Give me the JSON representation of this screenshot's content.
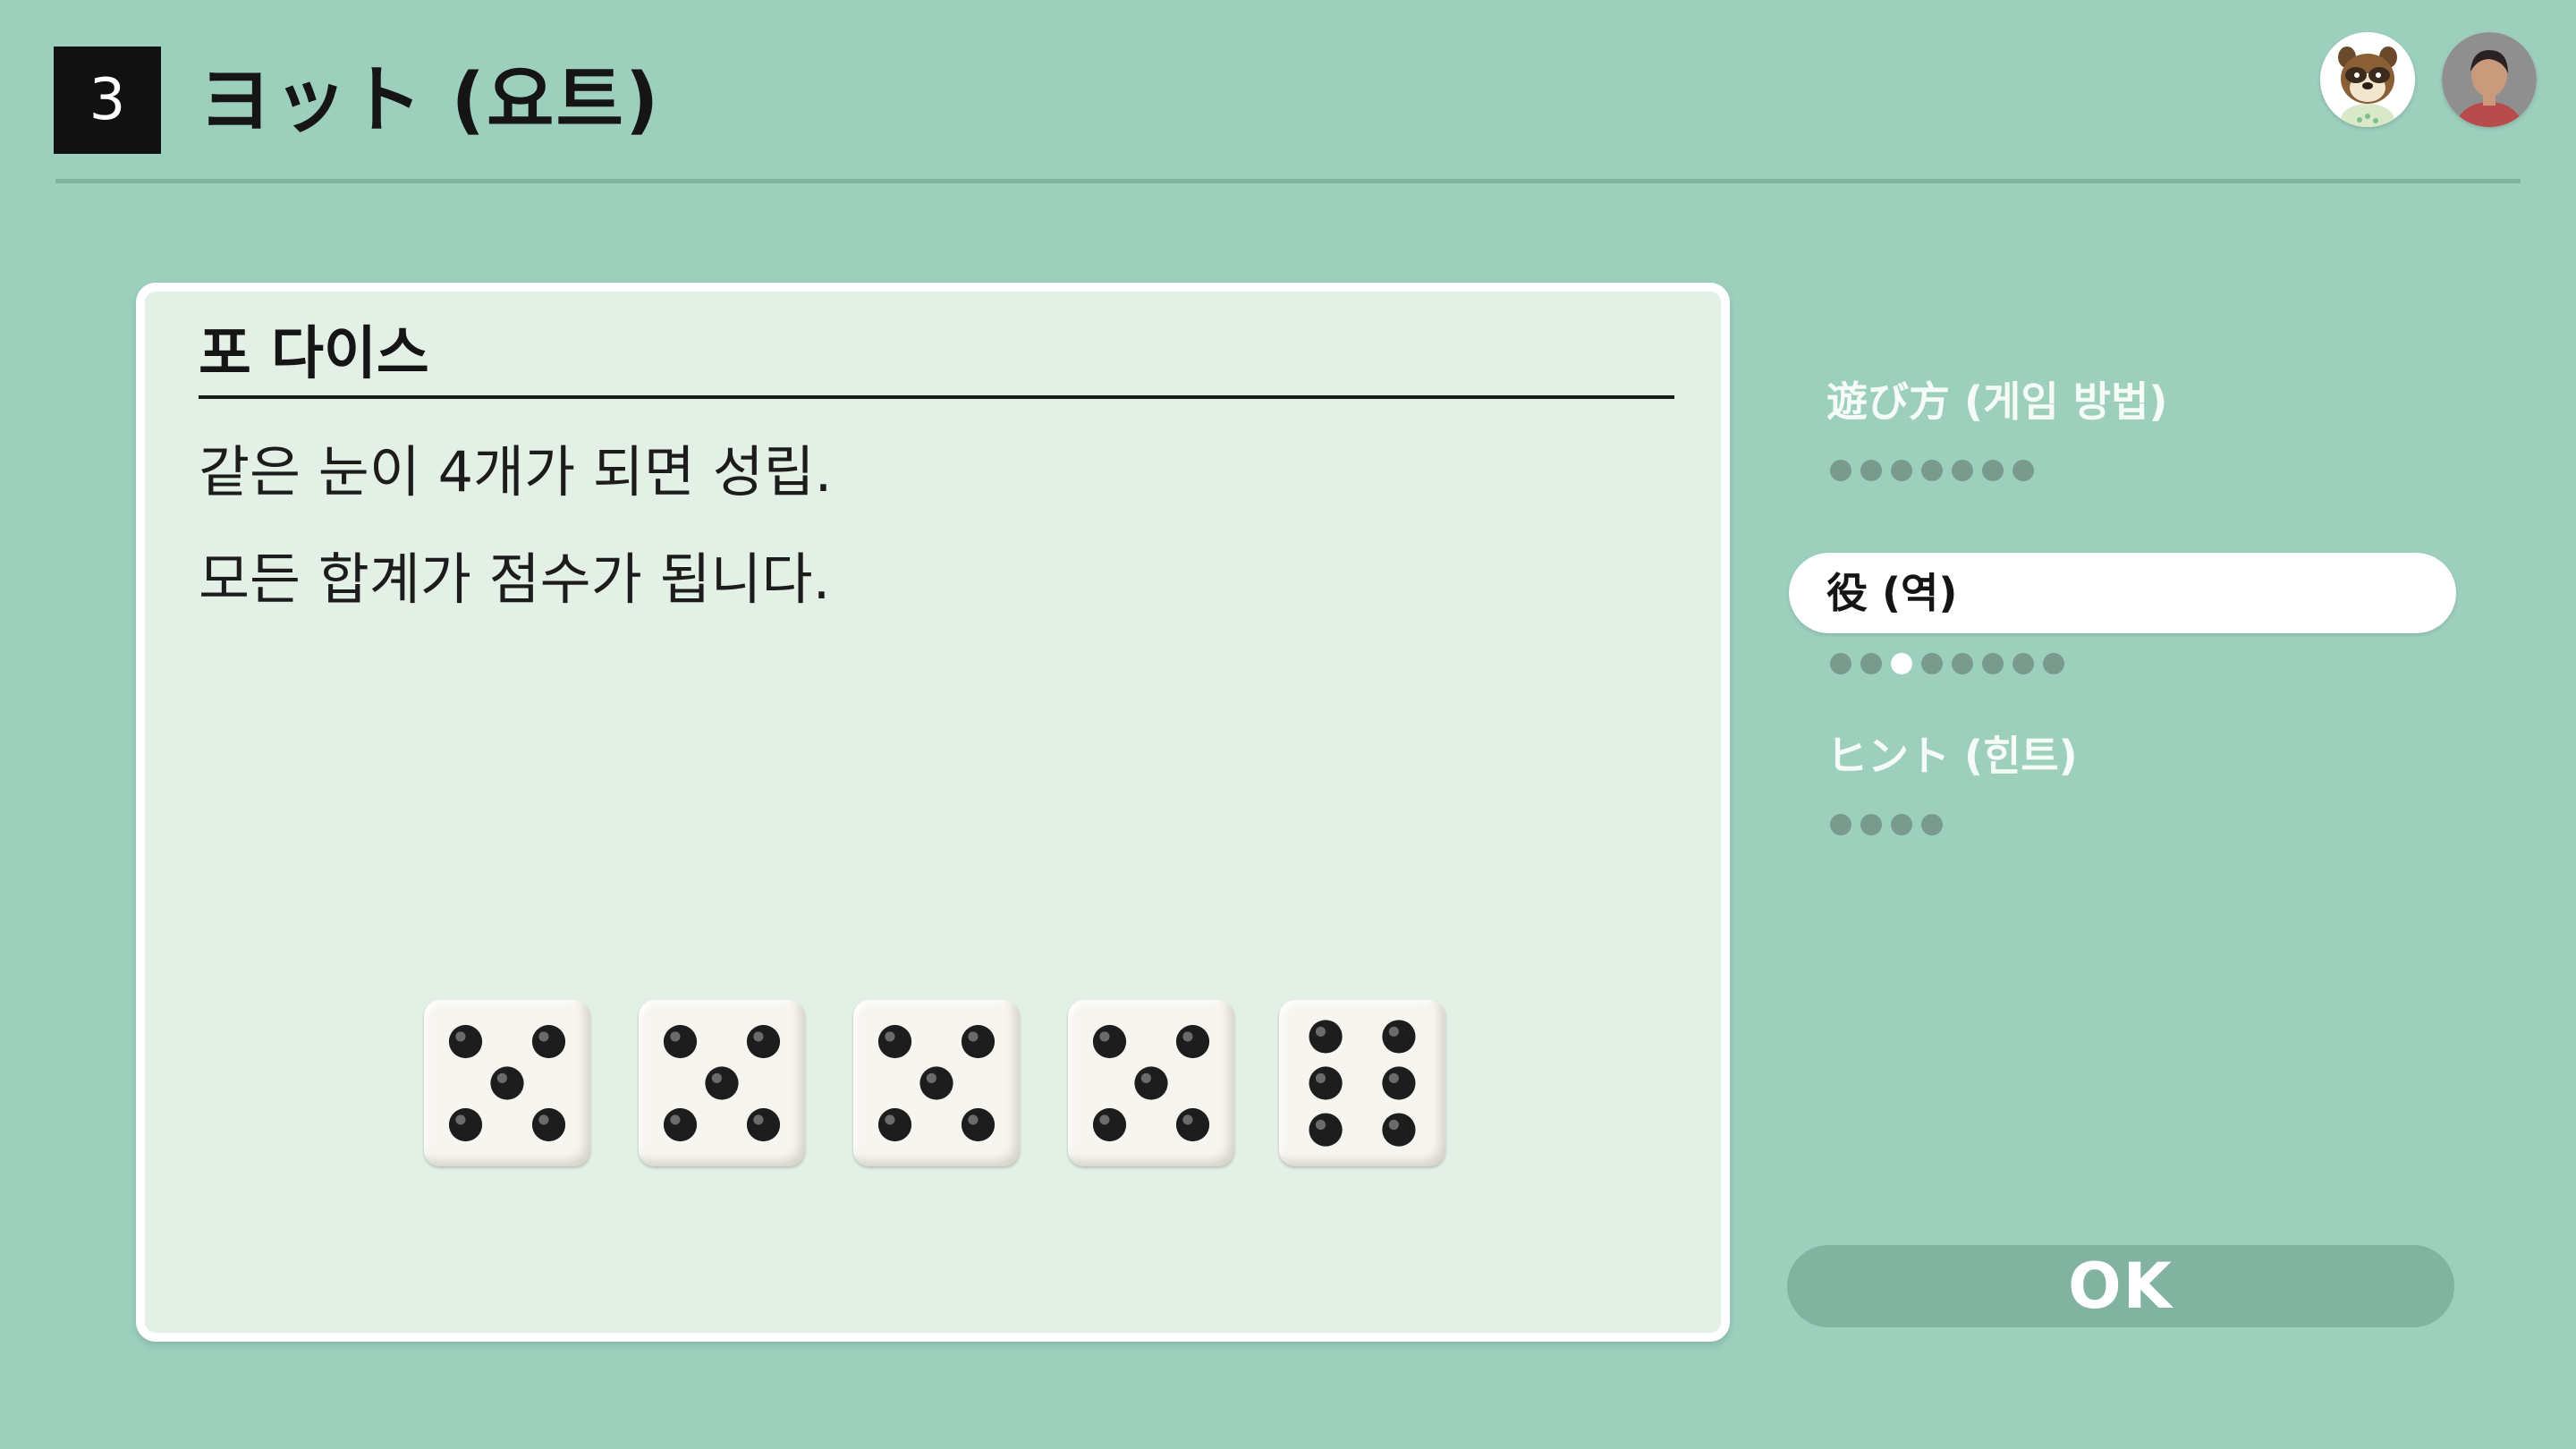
{
  "header": {
    "game_number": "3",
    "title": "ヨット (요트)"
  },
  "avatars": [
    {
      "icon": "raccoon-character-avatar-icon"
    },
    {
      "icon": "player-avatar-icon"
    }
  ],
  "panel": {
    "heading": "포 다이스",
    "lines": [
      "같은 눈이 4개가 되면 성립.",
      "모든 합계가 점수가 됩니다."
    ],
    "dice": [
      5,
      5,
      5,
      5,
      6
    ]
  },
  "menu": {
    "items": [
      {
        "label": "遊び方 (게임 방법)",
        "selected": false,
        "pages": 7,
        "current_page": null
      },
      {
        "label": "役 (역)",
        "selected": true,
        "pages": 8,
        "current_page": 3
      },
      {
        "label": "ヒント (힌트)",
        "selected": false,
        "pages": 4,
        "current_page": null
      }
    ]
  },
  "ok_button": {
    "label": "OK"
  },
  "colors": {
    "background": "#9dcfbd",
    "panel": "#e3f0e6",
    "dot_inactive": "#7a9a8e",
    "dot_active": "#ffffff",
    "ok_button": "#82b3a1"
  }
}
